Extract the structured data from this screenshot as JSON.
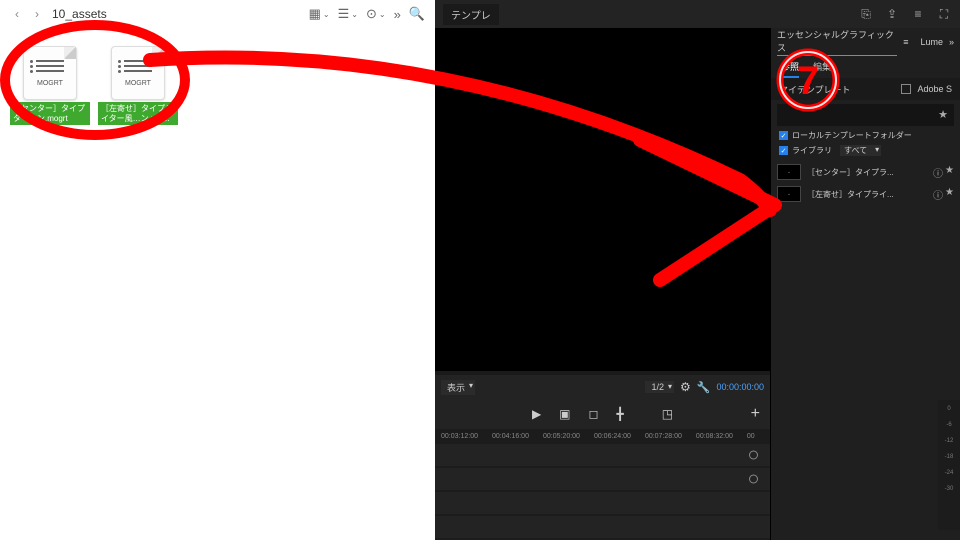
{
  "finder": {
    "folder": "10_assets",
    "files": [
      {
        "badge": "MOGRT",
        "name1": "［センター］タイプ",
        "name2": "ター…ン.mogrt"
      },
      {
        "badge": "MOGRT",
        "name1": "［左寄せ］タイプラ",
        "name2": "イター風…ン.mo…"
      }
    ]
  },
  "editor": {
    "tab": "テンプレ",
    "display_label": "表示",
    "ratio": "1/2",
    "timecode": "00:00:00:00",
    "ruler": [
      "00:03:12:00",
      "00:04:16:00",
      "00:05:20:00",
      "00:06:24:00",
      "00:07:28:00",
      "00:08:32:00",
      "00"
    ],
    "audio_scale": [
      "0",
      "-6",
      "-12",
      "-18",
      "-24",
      "-30"
    ]
  },
  "eg": {
    "title": "エッセンシャルグラフィックス",
    "lume": "Lume",
    "tab_browse": "参照",
    "tab_edit": "編集",
    "my_templates": "マイテンプレート",
    "adobe": "Adobe S",
    "filter_local": "ローカルテンプレートフォルダー",
    "filter_lib": "ライブラリ",
    "filter_lib_val": "すべて",
    "items": [
      "［センター］タイプラ...",
      "［左寄せ］タイプライ..."
    ]
  },
  "annotation": {
    "number": "7"
  }
}
